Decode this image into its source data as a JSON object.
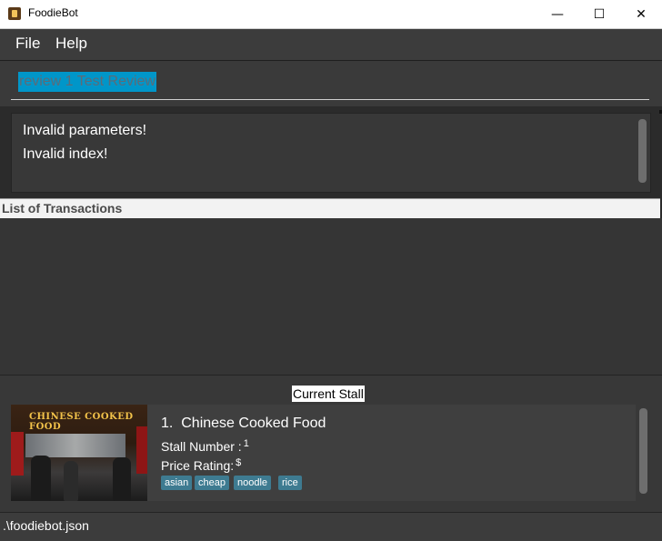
{
  "window": {
    "title": "FoodieBot",
    "minimize_symbol": "—",
    "maximize_symbol": "☐",
    "close_symbol": "✕"
  },
  "menu": {
    "items": [
      {
        "label": "File"
      },
      {
        "label": "Help"
      }
    ]
  },
  "command_box": {
    "value": "review 1 Test Review",
    "selected_color": "#0096c9"
  },
  "result_display": {
    "lines": [
      "Invalid parameters!",
      "Invalid index!"
    ]
  },
  "transactions": {
    "header": "List of Transactions",
    "items": []
  },
  "current_stall": {
    "label": "Current Stall",
    "index_label": "1.",
    "name": "Chinese Cooked Food",
    "stall_number_label": "Stall Number :",
    "stall_number": "1",
    "price_rating_label": "Price Rating:",
    "price_rating": "$",
    "photo_sign_text": "CHINESE COOKED FOOD",
    "tags": [
      "asian",
      "cheap",
      "noodle",
      "rice"
    ],
    "tag_color": "#3e7b91"
  },
  "status_bar": {
    "file_path": ".\\foodiebot.json"
  }
}
